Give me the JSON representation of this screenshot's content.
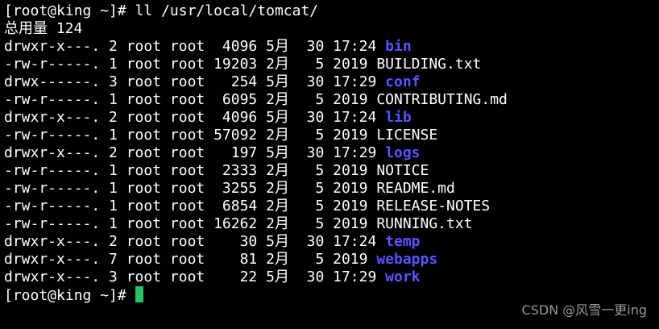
{
  "prompt_before": "[root@king ~]# ",
  "command": "ll /usr/local/tomcat/",
  "total_line": "总用量 124",
  "entries": [
    {
      "meta": "drwxr-x---. 2 root root  4096 5月  30 17:24 ",
      "name": "bin",
      "type": "dir"
    },
    {
      "meta": "-rw-r-----. 1 root root 19203 2月   5 2019 ",
      "name": "BUILDING.txt",
      "type": "file"
    },
    {
      "meta": "drwx------. 3 root root   254 5月  30 17:29 ",
      "name": "conf",
      "type": "dir"
    },
    {
      "meta": "-rw-r-----. 1 root root  6095 2月   5 2019 ",
      "name": "CONTRIBUTING.md",
      "type": "file"
    },
    {
      "meta": "drwxr-x---. 2 root root  4096 5月  30 17:24 ",
      "name": "lib",
      "type": "dir"
    },
    {
      "meta": "-rw-r-----. 1 root root 57092 2月   5 2019 ",
      "name": "LICENSE",
      "type": "file"
    },
    {
      "meta": "drwxr-x---. 2 root root   197 5月  30 17:29 ",
      "name": "logs",
      "type": "dir"
    },
    {
      "meta": "-rw-r-----. 1 root root  2333 2月   5 2019 ",
      "name": "NOTICE",
      "type": "file"
    },
    {
      "meta": "-rw-r-----. 1 root root  3255 2月   5 2019 ",
      "name": "README.md",
      "type": "file"
    },
    {
      "meta": "-rw-r-----. 1 root root  6854 2月   5 2019 ",
      "name": "RELEASE-NOTES",
      "type": "file"
    },
    {
      "meta": "-rw-r-----. 1 root root 16262 2月   5 2019 ",
      "name": "RUNNING.txt",
      "type": "file"
    },
    {
      "meta": "drwxr-x---. 2 root root    30 5月  30 17:24 ",
      "name": "temp",
      "type": "dir"
    },
    {
      "meta": "drwxr-x---. 7 root root    81 2月   5 2019 ",
      "name": "webapps",
      "type": "dir"
    },
    {
      "meta": "drwxr-x---. 3 root root    22 5月  30 17:29 ",
      "name": "work",
      "type": "dir"
    }
  ],
  "prompt_after": "[root@king ~]# ",
  "watermark": "CSDN @风雪一更ing",
  "colors": {
    "background": "#000000",
    "text": "#ffffff",
    "directory": "#5555ff",
    "cursor": "#22c55e"
  }
}
